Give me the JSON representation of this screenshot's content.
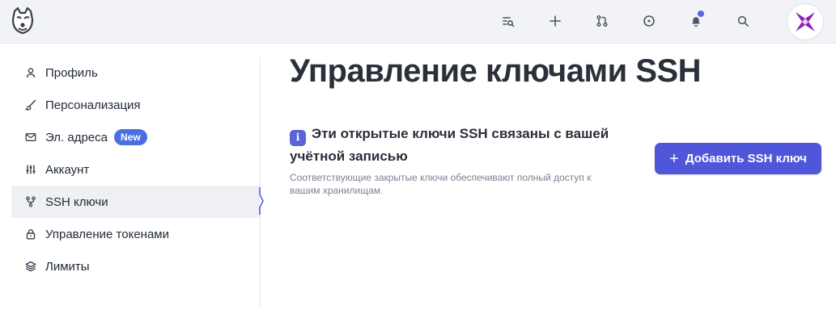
{
  "header": {
    "logo_icon": "dog-logo-icon",
    "actions": [
      {
        "name": "list-search-button",
        "icon": "list-search-icon"
      },
      {
        "name": "create-button",
        "icon": "plus-icon"
      },
      {
        "name": "pull-requests-button",
        "icon": "git-pull-request-icon"
      },
      {
        "name": "issues-button",
        "icon": "circle-dot-icon"
      },
      {
        "name": "notifications-button",
        "icon": "bell-icon"
      },
      {
        "name": "search-button",
        "icon": "search-icon"
      }
    ],
    "notification_dot_color": "#5865e6",
    "avatar_icon": "purple-star-avatar"
  },
  "sidebar": {
    "items": [
      {
        "label": "Профиль",
        "icon": "user-icon"
      },
      {
        "label": "Персонализация",
        "icon": "brush-icon"
      },
      {
        "label": "Эл. адреса",
        "icon": "mail-icon",
        "badge": "New"
      },
      {
        "label": "Аккаунт",
        "icon": "sliders-icon"
      },
      {
        "label": "SSH ключи",
        "icon": "git-fork-icon",
        "active": true
      },
      {
        "label": "Управление токенами",
        "icon": "lock-icon"
      },
      {
        "label": "Лимиты",
        "icon": "layers-icon"
      }
    ]
  },
  "main": {
    "title": "Управление ключами SSH",
    "info": {
      "icon": "info-icon",
      "icon_glyph": "i",
      "title": "Эти открытые ключи SSH связаны с вашей учётной записью",
      "description": "Соответствующие закрытые ключи обеспечивают полный доступ к вашим хранилищам."
    },
    "add_button": {
      "icon_glyph": "+",
      "label": "Добавить SSH ключ"
    }
  },
  "colors": {
    "accent": "#4f56d9",
    "badge": "#4c6fe0",
    "topbar_bg": "#f1f3f6",
    "active_item_bg": "#eef0f3"
  }
}
